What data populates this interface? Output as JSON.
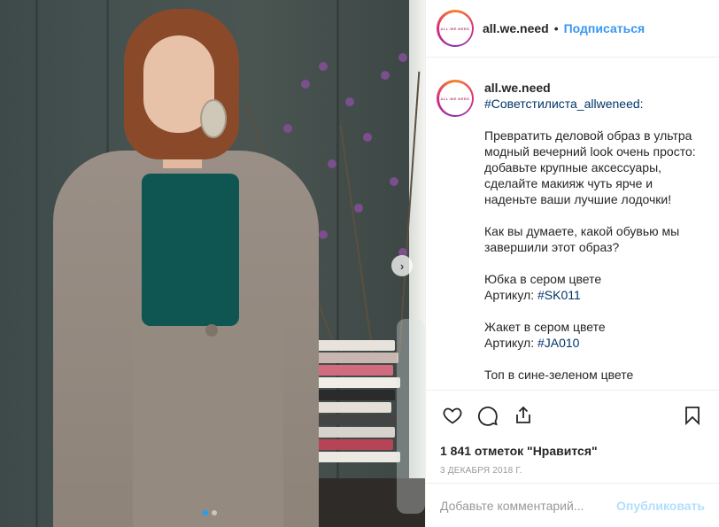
{
  "post": {
    "username": "all.we.need",
    "avatar_text": "ALL.WE.NEED",
    "follow_label": "Подписаться",
    "bullet": "•"
  },
  "caption": {
    "author": "all.we.need",
    "hashtag": "#Советстилиста_allweneed:",
    "paragraph1": "Превратить деловой образ в ультра модный вечерний look очень просто: добавьте крупные аксессуары, сделайте макияж чуть ярче и наденьте ваши лучшие лодочки!",
    "paragraph2": "Как вы думаете, какой обувью мы завершили этот образ?",
    "item1_name": "Юбка в сером цвете",
    "item1_sku_label": "Артикул: ",
    "item1_sku": "#SK011",
    "item2_name": "Жакет в сером цвете",
    "item2_sku_label": "Артикул: ",
    "item2_sku": "#JA010",
    "item3_name": "Топ в сине-зеленом цвете"
  },
  "actions": {
    "icons": [
      "heart-icon",
      "comment-icon",
      "share-icon",
      "bookmark-icon"
    ]
  },
  "likes": "1 841 отметок \"Нравится\"",
  "date": "3 декабря 2018 г.",
  "comment_box": {
    "placeholder": "Добавьте комментарий...",
    "publish_label": "Опубликовать"
  },
  "carousel": {
    "next_glyph": "›",
    "slides": 2,
    "active_slide": 1
  },
  "colors": {
    "link": "#3897f0",
    "hashtag": "#003569",
    "publish_disabled": "#b2dffc",
    "active_dot": "#1ea1f2"
  }
}
